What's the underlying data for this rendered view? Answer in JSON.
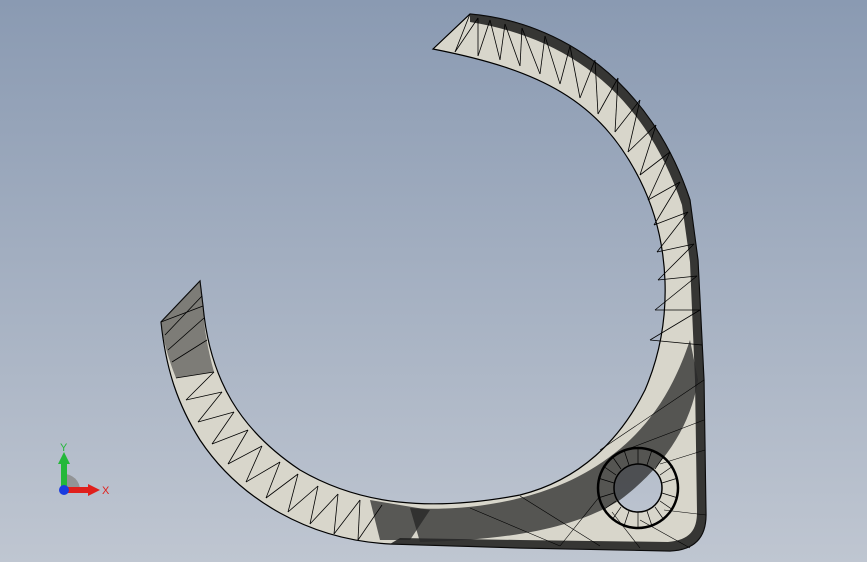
{
  "viewport": {
    "background_top": "#8a9ab2",
    "background_bottom": "#bfc6d1"
  },
  "model": {
    "face_color": "#d8d6cb",
    "edge_color": "#000000"
  },
  "triad": {
    "x_label": "X",
    "y_label": "Y",
    "x_color": "#e0201c",
    "y_color": "#24b83a",
    "z_color": "#1a3ce0"
  }
}
